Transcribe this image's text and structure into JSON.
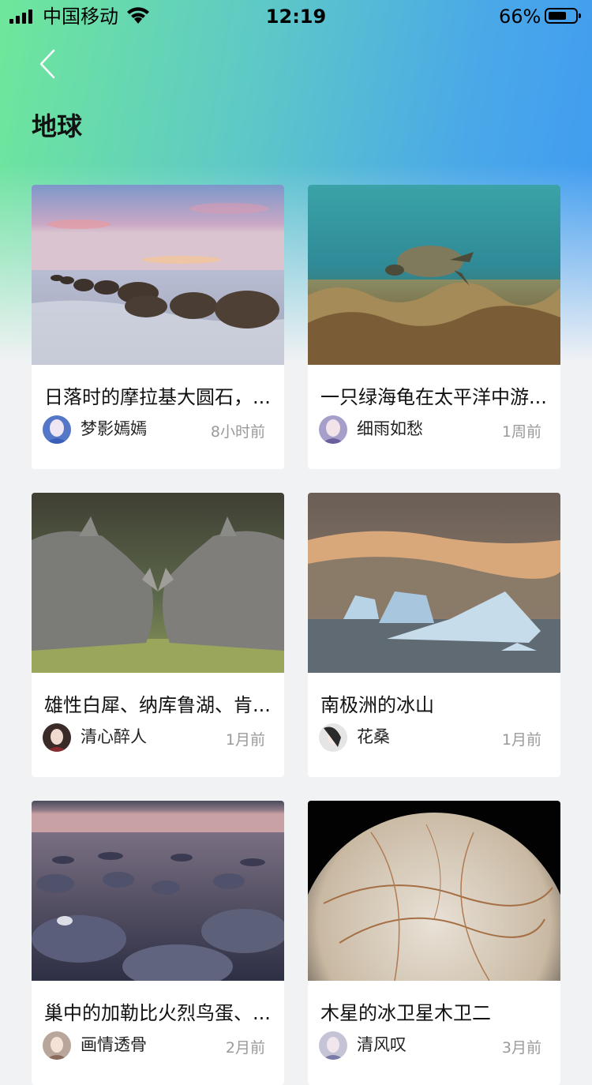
{
  "status_bar": {
    "carrier": "中国移动",
    "time": "12:19",
    "battery_percent": "66%"
  },
  "header": {
    "back_icon": "chevron-left-icon",
    "title": "地球"
  },
  "colors": {
    "gradient_start": "#6fe79a",
    "gradient_end": "#3f9af2",
    "page_bg": "#f1f2f4"
  },
  "cards": [
    {
      "title": "日落时的摩拉基大圆石，...",
      "author": "梦影嫣嫣",
      "time": "8小时前",
      "image": "boulders-beach-sunset"
    },
    {
      "title": "一只绿海龟在太平洋中游...",
      "author": "细雨如愁",
      "time": "1周前",
      "image": "sea-turtle-coral"
    },
    {
      "title": "雄性白犀、纳库鲁湖、肯...",
      "author": "清心醉人",
      "time": "1月前",
      "image": "white-rhinos"
    },
    {
      "title": "南极洲的冰山",
      "author": "花桑",
      "time": "1月前",
      "image": "antarctic-icebergs"
    },
    {
      "title": "巢中的加勒比火烈鸟蛋、...",
      "author": "画情透骨",
      "time": "2月前",
      "image": "flamingo-nests"
    },
    {
      "title": "木星的冰卫星木卫二",
      "author": "清风叹",
      "time": "3月前",
      "image": "europa-moon"
    }
  ]
}
